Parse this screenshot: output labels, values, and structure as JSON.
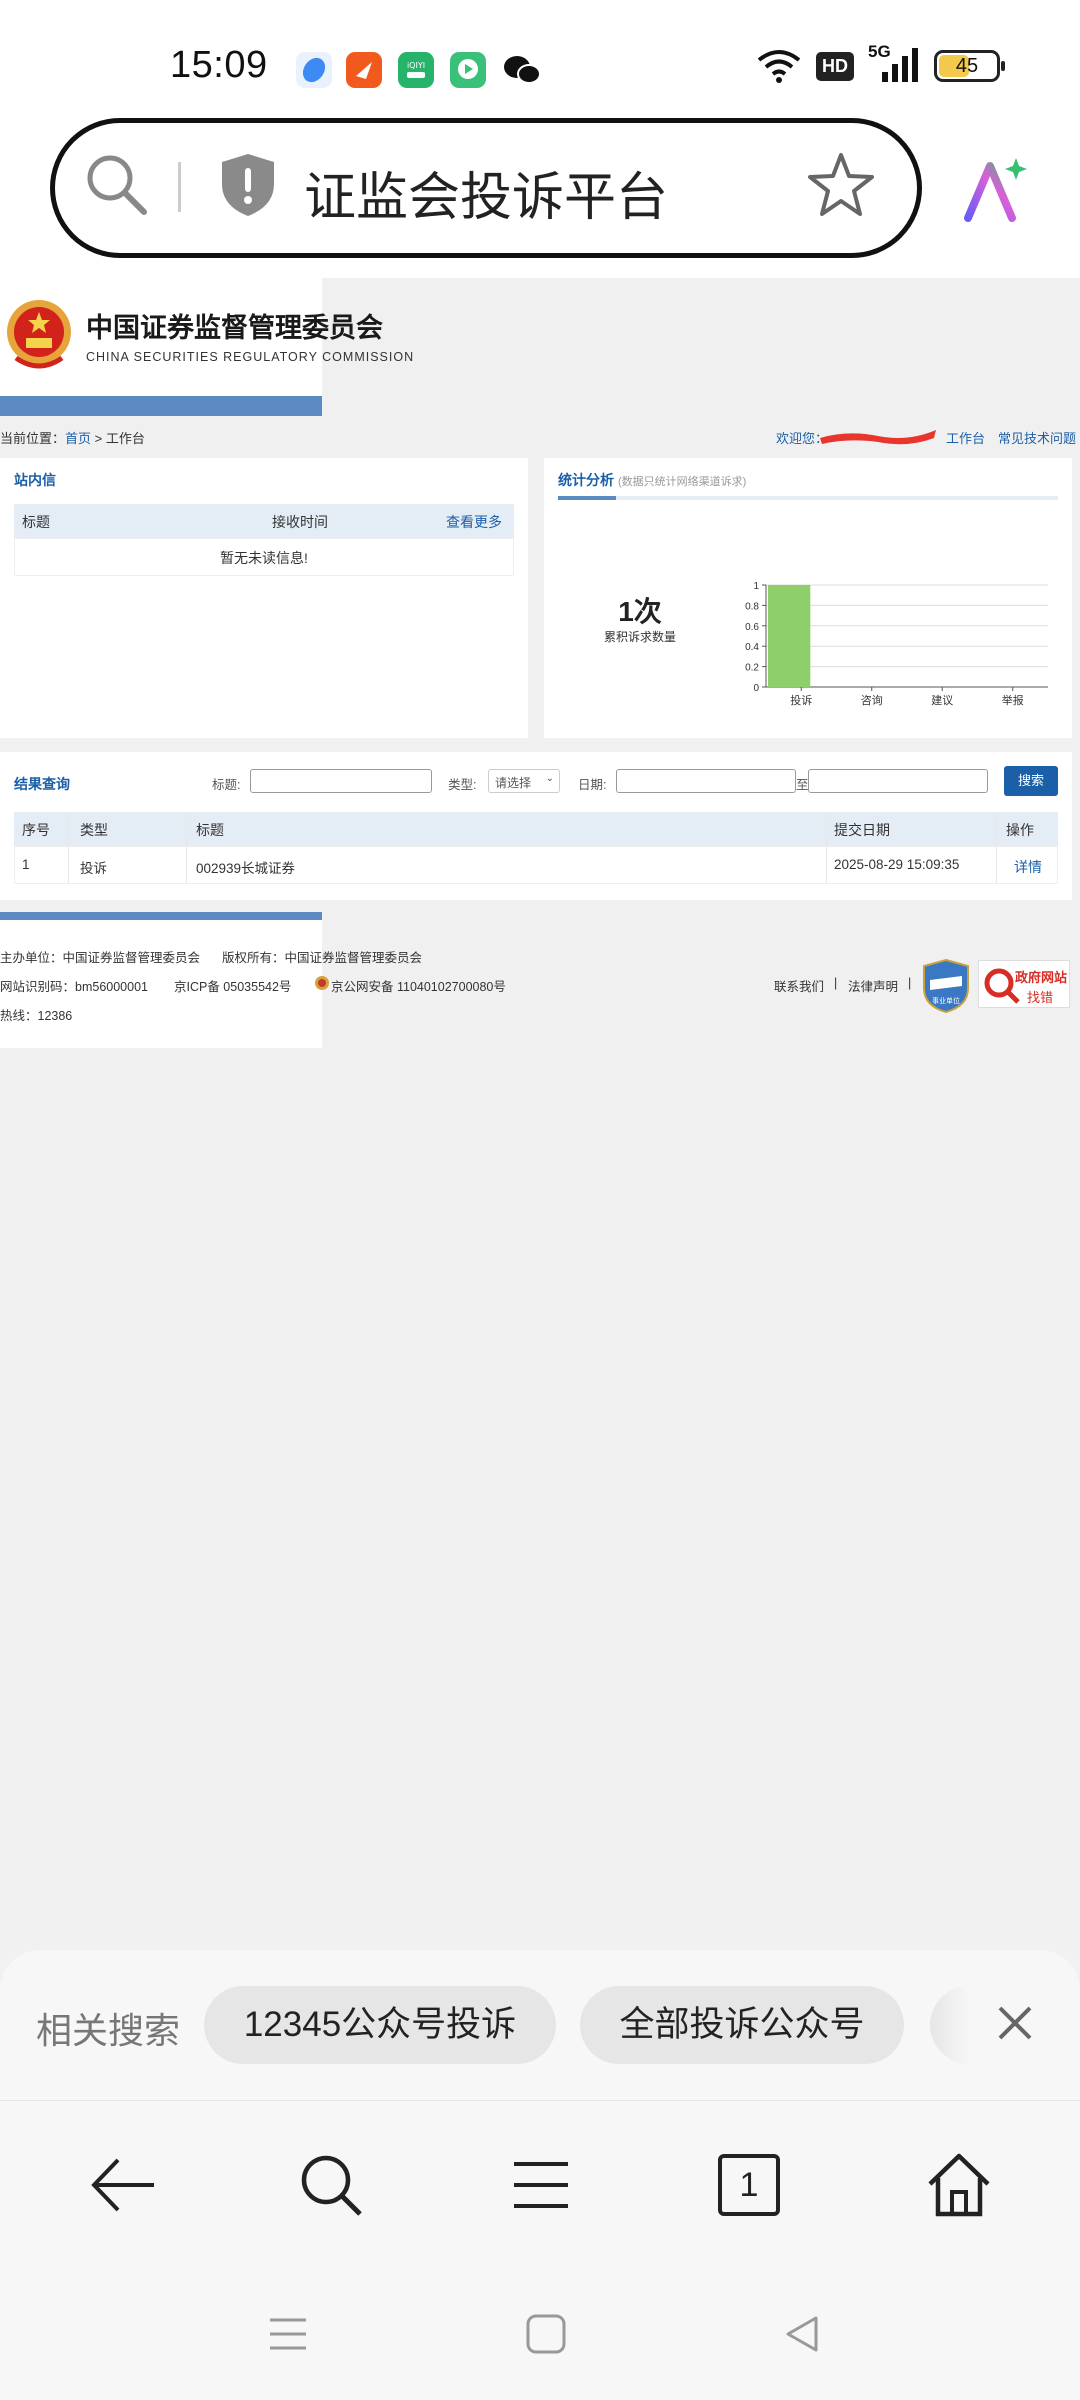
{
  "status_bar": {
    "time": "15:09",
    "hd": "HD",
    "network": "5G",
    "battery": "45",
    "colors": {
      "app1": "#3d8bf2",
      "app2": "#f25a1d",
      "app3": "#28b36b",
      "app4": "#3bc07a"
    }
  },
  "address_bar": {
    "query": "证监会投诉平台",
    "icons": [
      "search-icon",
      "shield-icon",
      "star-icon",
      "ai-icon"
    ]
  },
  "site": {
    "name_cn": "中国证券监督管理委员会",
    "name_en": "CHINA SECURITIES REGULATORY COMMISSION",
    "breadcrumb_prefix": "当前位置：",
    "breadcrumb_home": "首页",
    "breadcrumb_sep": " > ",
    "breadcrumb_current": "工作台",
    "welcome": "欢迎您：",
    "nav_workbench": "工作台",
    "nav_faq": "常见技术问题"
  },
  "inbox": {
    "title": "站内信",
    "col_title": "标题",
    "col_time": "接收时间",
    "more": "查看更多",
    "empty": "暂无未读信息!"
  },
  "stats": {
    "title": "统计分析",
    "note": "(数据只统计网络渠道诉求)",
    "count": "1次",
    "count_label": "累积诉求数量",
    "bar_color": "#8fcf6b"
  },
  "chart_data": {
    "type": "bar",
    "categories": [
      "投诉",
      "咨询",
      "建议",
      "举报"
    ],
    "values": [
      1,
      0,
      0,
      0
    ],
    "ylim": [
      0,
      1
    ],
    "yticks": [
      "0",
      "0.2",
      "0.4",
      "0.6",
      "0.8",
      "1"
    ],
    "grid": true
  },
  "results": {
    "title": "结果查询",
    "label_title": "标题:",
    "label_type": "类型:",
    "type_select": "请选择",
    "label_date": "日期:",
    "date_to": "至",
    "search_btn": "搜索",
    "columns": [
      "序号",
      "类型",
      "标题",
      "提交日期",
      "操作"
    ],
    "rows": [
      {
        "no": "1",
        "type": "投诉",
        "title": "002939长城证券",
        "date": "2025-08-29 15:09:35",
        "action": "详情"
      }
    ]
  },
  "footer": {
    "host": "主办单位：中国证券监督管理委员会",
    "copyright": "版权所有：中国证券监督管理委员会",
    "site_id": "网站识别码：bm56000001",
    "icp": "京ICP备 05035542号",
    "police": "京公网安备 11040102700080号",
    "hotline": "热线：12386",
    "contact": "联系我们",
    "sep": "|",
    "legal": "法律声明",
    "badge_text": "事业单位",
    "gov_text_1": "政府网站",
    "gov_text_2": "找错"
  },
  "related": {
    "label": "相关搜索",
    "chips": [
      "12345公众号投诉",
      "全部投诉公众号"
    ]
  }
}
